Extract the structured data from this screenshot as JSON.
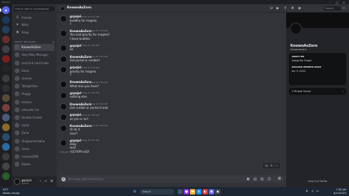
{
  "window": {
    "title": "Discord"
  },
  "sidebar": {
    "search_placeholder": "Find or start a conversation",
    "nav": [
      {
        "label": "Friends",
        "icon": "friends-icon"
      },
      {
        "label": "Nitro",
        "icon": "nitro-icon"
      },
      {
        "label": "Shop",
        "icon": "shop-icon"
      }
    ],
    "dm_header": "DIRECT MESSAGES",
    "dms": [
      "KnownAsZoro",
      "Holy Moly Manager",
      "land link land trade",
      "Kams",
      "cleome",
      "TwilightStar",
      "Huggy",
      "lemons",
      "sahasika 1st",
      "Double Cluster",
      "opoly",
      "Zorai",
      "illingaarne!kakar",
      "Arnav",
      "nessassDSB",
      "Babee"
    ]
  },
  "user_panel": {
    "name": "grpnjel",
    "status": "Online"
  },
  "header": {
    "name": "KnownAsZoro",
    "search_placeholder": "Search"
  },
  "messages": [
    {
      "author": "grpnjel",
      "time": "Today at 7:51 AM",
      "lines": [
        "buddha for magma",
        "?"
      ]
    },
    {
      "author": "KnownAsZoro",
      "time": "Today at 7:52 AM",
      "lines": [
        "You said gravity for magma?",
        "I have buddha"
      ]
    },
    {
      "author": "grpnjel",
      "time": "Today at 7:53 AM",
      "lines": [
        "ok"
      ]
    },
    {
      "author": "KnownAsZoro",
      "time": "Today at 7:53 AM",
      "lines": [
        "Got portal or rumble?"
      ]
    },
    {
      "author": "grpnjel",
      "time": "Today at 7:53 AM",
      "lines": [
        "gravity for magma",
        "?"
      ]
    },
    {
      "author": "KnownAsZoro",
      "time": "Today at 7:55 AM",
      "lines": [
        "What else you have?"
      ]
    },
    {
      "author": "grpnjel",
      "time": "Today at 7:55 AM",
      "lines": [
        "nothing else"
      ]
    },
    {
      "author": "KnownAsZoro",
      "time": "Today at 7:56 AM",
      "lines": [
        "Got rumble or portal ill add"
      ]
    },
    {
      "author": "grpnjel",
      "time": "Today at 7:56 AM",
      "lines": [
        "xe yes or no?"
      ]
    },
    {
      "author": "KnownAsZoro",
      "time": "Today at 7:56 AM",
      "lines": [
        "Hi do it",
        "User?"
      ]
    },
    {
      "author": "grpnjel",
      "time": "Today at 7:57 AM",
      "lines": [
        "okay",
        "wait",
        "rGCYSPYvvGX"
      ]
    }
  ],
  "last_stamp": "7:58 AM",
  "composer": {
    "placeholder": "Message @KnownAsZoro"
  },
  "profile": {
    "name": "KnownAsZoro",
    "tag": "knownaszoro",
    "about_heading": "ABOUT ME",
    "about_text": "Adopt Me Trader",
    "member_heading": "DISCORD MEMBER SINCE",
    "member_since": "Jun 9, 2022",
    "mutual": "1 Mutual Server",
    "full_profile": "View Full Profile"
  },
  "taskbar": {
    "weather_temp": "54°F",
    "weather_desc": "Mostly cloudy",
    "search": "Search",
    "time": "7:58 AM",
    "date": "8/14/2023"
  }
}
